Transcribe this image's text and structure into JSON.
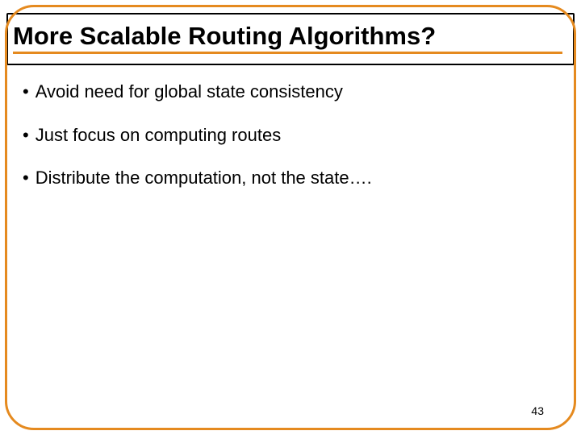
{
  "slide": {
    "title": "More Scalable Routing Algorithms?",
    "bullets": [
      "Avoid need for global state consistency",
      "Just focus on computing routes",
      "Distribute the computation, not the state…."
    ],
    "page_number": "43"
  }
}
